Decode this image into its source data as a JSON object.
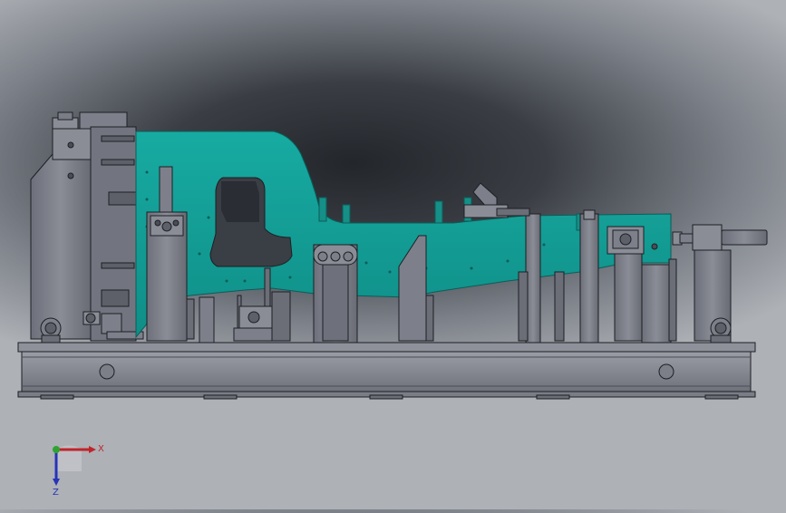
{
  "viewport": {
    "background_top": "#23262b",
    "background_bottom": "#aeb1b6"
  },
  "model": {
    "main_part_color": "#14a29a",
    "fixture_color": "#7d808a",
    "fixture_dark": "#5d6069",
    "base_color": "#8b8e97",
    "edge_color": "#1d1f24"
  },
  "triad": {
    "x_label": "X",
    "y_label": "Y",
    "z_label": "Z",
    "x_color": "#c0242a",
    "y_color": "#2fa32f",
    "z_color": "#2733b8"
  }
}
